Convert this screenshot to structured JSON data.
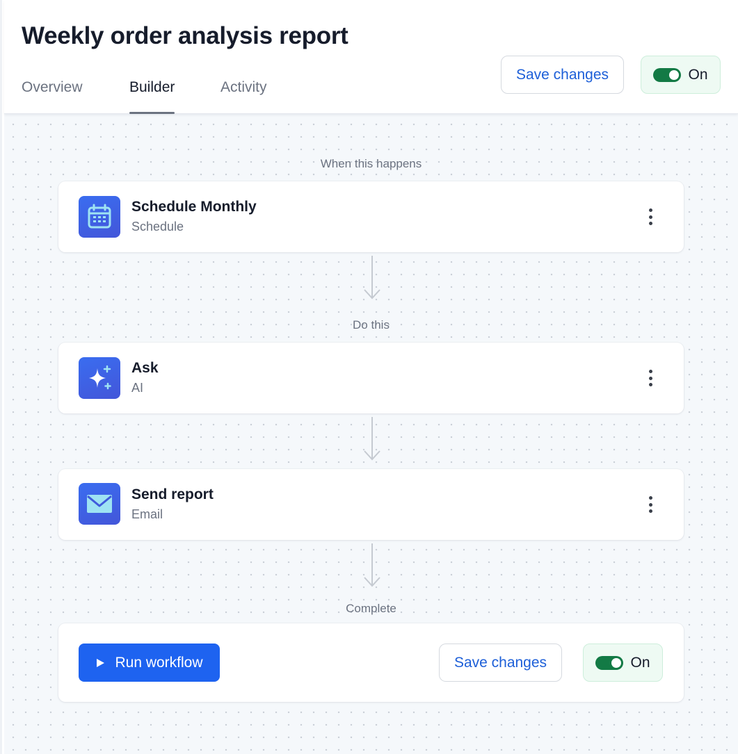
{
  "header": {
    "title": "Weekly order analysis report",
    "tabs": [
      {
        "label": "Overview",
        "active": false
      },
      {
        "label": "Builder",
        "active": true
      },
      {
        "label": "Activity",
        "active": false
      }
    ],
    "save_label": "Save changes",
    "toggle_label": "On"
  },
  "builder": {
    "trigger_label": "When this happens",
    "action_label": "Do this",
    "complete_label": "Complete",
    "steps": [
      {
        "title": "Schedule Monthly",
        "subtitle": "Schedule",
        "icon": "calendar-icon"
      },
      {
        "title": "Ask",
        "subtitle": "AI",
        "icon": "sparkle-icon"
      },
      {
        "title": "Send report",
        "subtitle": "Email",
        "icon": "envelope-icon"
      }
    ]
  },
  "footer": {
    "run_label": "Run workflow",
    "save_label": "Save changes",
    "toggle_label": "On"
  },
  "colors": {
    "accent": "#1e63f0",
    "link": "#1d5fd8",
    "toggle_on": "#137a45",
    "toggle_bg": "#eefaf3"
  }
}
